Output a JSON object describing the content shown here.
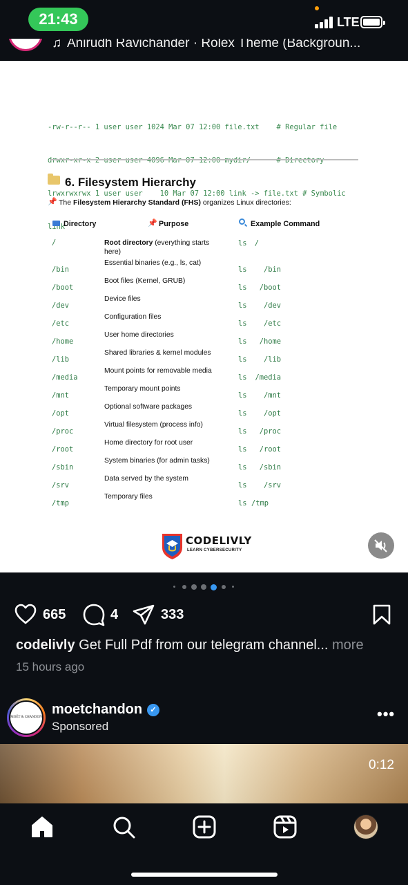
{
  "status_bar": {
    "time": "21:43",
    "network": "LTE"
  },
  "post_header": {
    "music": "Anirudh Ravichander · Rolex Theme (Backgroun..."
  },
  "post_image": {
    "code_lines": [
      "-rw-r--r-- 1 user user 1024 Mar 07 12:00 file.txt    # Regular file",
      "drwxr-xr-x 2 user user 4096 Mar 07 12:00 mydir/      # Directory",
      "lrwxrwxrwx 1 user user    10 Mar 07 12:00 link -> file.txt # Symbolic",
      "link"
    ],
    "section_title": "6. Filesystem Hierarchy",
    "intro_pre": "The ",
    "intro_bold": "Filesystem Hierarchy Standard (FHS)",
    "intro_post": " organizes Linux directories:",
    "headers": {
      "directory": "Directory",
      "purpose": "Purpose",
      "command": "Example Command"
    },
    "rows": [
      {
        "dir": "/",
        "purpose_bold": "Root directory",
        "purpose": " (everything starts here)",
        "cmd_ls": "ls",
        "cmd_arg": "/"
      },
      {
        "dir": "/bin",
        "purpose_bold": "",
        "purpose": "Essential binaries (e.g., ls, cat)",
        "cmd_ls": "ls",
        "cmd_arg": "/bin"
      },
      {
        "dir": "/boot",
        "purpose_bold": "",
        "purpose": "Boot files (Kernel, GRUB)",
        "cmd_ls": "ls",
        "cmd_arg": "/boot"
      },
      {
        "dir": "/dev",
        "purpose_bold": "",
        "purpose": "Device files",
        "cmd_ls": "ls",
        "cmd_arg": "/dev"
      },
      {
        "dir": "/etc",
        "purpose_bold": "",
        "purpose": "Configuration files",
        "cmd_ls": "ls",
        "cmd_arg": "/etc"
      },
      {
        "dir": "/home",
        "purpose_bold": "",
        "purpose": "User home directories",
        "cmd_ls": "ls",
        "cmd_arg": "/home"
      },
      {
        "dir": "/lib",
        "purpose_bold": "",
        "purpose": "Shared libraries & kernel modules",
        "cmd_ls": "ls",
        "cmd_arg": "/lib"
      },
      {
        "dir": "/media",
        "purpose_bold": "",
        "purpose": "Mount points for removable media",
        "cmd_ls": "ls",
        "cmd_arg": "/media"
      },
      {
        "dir": "/mnt",
        "purpose_bold": "",
        "purpose": "Temporary mount points",
        "cmd_ls": "ls",
        "cmd_arg": "/mnt"
      },
      {
        "dir": "/opt",
        "purpose_bold": "",
        "purpose": "Optional software packages",
        "cmd_ls": "ls",
        "cmd_arg": "/opt"
      },
      {
        "dir": "/proc",
        "purpose_bold": "",
        "purpose": "Virtual filesystem (process info)",
        "cmd_ls": "ls",
        "cmd_arg": "/proc"
      },
      {
        "dir": "/root",
        "purpose_bold": "",
        "purpose": "Home directory for root user",
        "cmd_ls": "ls",
        "cmd_arg": "/root"
      },
      {
        "dir": "/sbin",
        "purpose_bold": "",
        "purpose": "System binaries (for admin tasks)",
        "cmd_ls": "ls",
        "cmd_arg": "/sbin"
      },
      {
        "dir": "/srv",
        "purpose_bold": "",
        "purpose": "Data served by the system",
        "cmd_ls": "ls",
        "cmd_arg": "/srv"
      },
      {
        "dir": "/tmp",
        "purpose_bold": "",
        "purpose": "Temporary files",
        "cmd_ls": "ls",
        "cmd_arg": "/tmp"
      }
    ],
    "logo_name": "CODELIVLY",
    "logo_tagline": "LEARN CYBERSECURITY"
  },
  "carousel": {
    "count": 7,
    "active": 4
  },
  "actions": {
    "likes": "665",
    "comments": "4",
    "shares": "333"
  },
  "caption": {
    "user": "codelivly",
    "text": " Get Full Pdf from our telegram channel...",
    "more": " more"
  },
  "time_ago": "15 hours ago",
  "sponsored_post": {
    "account": "moetchandon",
    "label": "Sponsored",
    "avatar_text": "MOËT & CHANDON",
    "video_time": "0:12"
  },
  "icons": {
    "home": "home-icon",
    "search": "search-icon",
    "create": "plus-square-icon",
    "reels": "reels-icon",
    "like": "heart-icon",
    "comment": "comment-icon",
    "share": "paper-plane-icon",
    "save": "bookmark-icon",
    "mute": "speaker-muted-icon"
  },
  "colors": {
    "accent_blue": "#3897f0",
    "status_green": "#34c759",
    "code_green": "#2d7a45"
  }
}
